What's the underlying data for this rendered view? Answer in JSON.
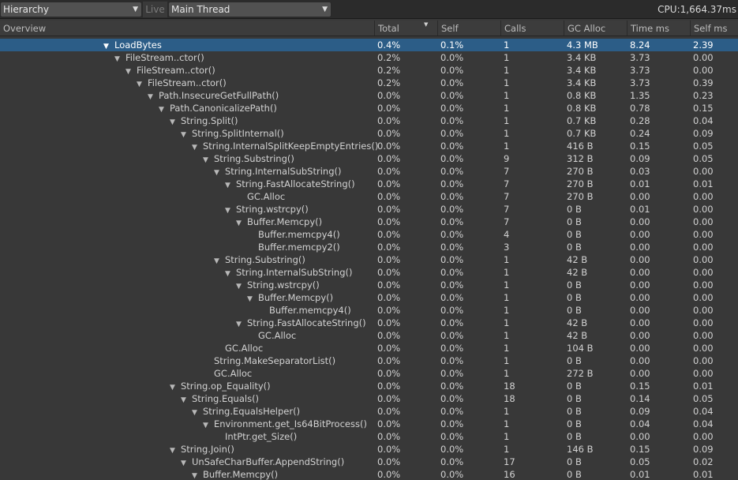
{
  "toolbar": {
    "view_mode": "Hierarchy",
    "live_label": "Live",
    "thread": "Main Thread",
    "cpu": "CPU:1,664.37ms"
  },
  "columns": [
    "Overview",
    "Total",
    "Self",
    "Calls",
    "GC Alloc",
    "Time ms",
    "Self ms"
  ],
  "rows": [
    {
      "name": "LoadBytes",
      "depth": 0,
      "expanded": true,
      "selected": true,
      "total": "0.4%",
      "self": "0.1%",
      "calls": "1",
      "gc_alloc": "4.3 MB",
      "time_ms": "8.24",
      "self_ms": "2.39"
    },
    {
      "name": "FileStream..ctor()",
      "depth": 1,
      "expanded": true,
      "total": "0.2%",
      "self": "0.0%",
      "calls": "1",
      "gc_alloc": "3.4 KB",
      "time_ms": "3.73",
      "self_ms": "0.00"
    },
    {
      "name": "FileStream..ctor()",
      "depth": 2,
      "expanded": true,
      "total": "0.2%",
      "self": "0.0%",
      "calls": "1",
      "gc_alloc": "3.4 KB",
      "time_ms": "3.73",
      "self_ms": "0.00"
    },
    {
      "name": "FileStream..ctor()",
      "depth": 3,
      "expanded": true,
      "total": "0.2%",
      "self": "0.0%",
      "calls": "1",
      "gc_alloc": "3.4 KB",
      "time_ms": "3.73",
      "self_ms": "0.39"
    },
    {
      "name": "Path.InsecureGetFullPath()",
      "depth": 4,
      "expanded": true,
      "total": "0.0%",
      "self": "0.0%",
      "calls": "1",
      "gc_alloc": "0.8 KB",
      "time_ms": "1.35",
      "self_ms": "0.23"
    },
    {
      "name": "Path.CanonicalizePath()",
      "depth": 5,
      "expanded": true,
      "total": "0.0%",
      "self": "0.0%",
      "calls": "1",
      "gc_alloc": "0.8 KB",
      "time_ms": "0.78",
      "self_ms": "0.15"
    },
    {
      "name": "String.Split()",
      "depth": 6,
      "expanded": true,
      "total": "0.0%",
      "self": "0.0%",
      "calls": "1",
      "gc_alloc": "0.7 KB",
      "time_ms": "0.28",
      "self_ms": "0.04"
    },
    {
      "name": "String.SplitInternal()",
      "depth": 7,
      "expanded": true,
      "total": "0.0%",
      "self": "0.0%",
      "calls": "1",
      "gc_alloc": "0.7 KB",
      "time_ms": "0.24",
      "self_ms": "0.09"
    },
    {
      "name": "String.InternalSplitKeepEmptyEntries()",
      "depth": 8,
      "expanded": true,
      "total": "0.0%",
      "self": "0.0%",
      "calls": "1",
      "gc_alloc": "416 B",
      "time_ms": "0.15",
      "self_ms": "0.05"
    },
    {
      "name": "String.Substring()",
      "depth": 9,
      "expanded": true,
      "total": "0.0%",
      "self": "0.0%",
      "calls": "9",
      "gc_alloc": "312 B",
      "time_ms": "0.09",
      "self_ms": "0.05"
    },
    {
      "name": "String.InternalSubString()",
      "depth": 10,
      "expanded": true,
      "total": "0.0%",
      "self": "0.0%",
      "calls": "7",
      "gc_alloc": "270 B",
      "time_ms": "0.03",
      "self_ms": "0.00"
    },
    {
      "name": "String.FastAllocateString()",
      "depth": 11,
      "expanded": true,
      "total": "0.0%",
      "self": "0.0%",
      "calls": "7",
      "gc_alloc": "270 B",
      "time_ms": "0.01",
      "self_ms": "0.01"
    },
    {
      "name": "GC.Alloc",
      "depth": 12,
      "expanded": false,
      "total": "0.0%",
      "self": "0.0%",
      "calls": "7",
      "gc_alloc": "270 B",
      "time_ms": "0.00",
      "self_ms": "0.00"
    },
    {
      "name": "String.wstrcpy()",
      "depth": 11,
      "expanded": true,
      "total": "0.0%",
      "self": "0.0%",
      "calls": "7",
      "gc_alloc": "0 B",
      "time_ms": "0.01",
      "self_ms": "0.00"
    },
    {
      "name": "Buffer.Memcpy()",
      "depth": 12,
      "expanded": true,
      "total": "0.0%",
      "self": "0.0%",
      "calls": "7",
      "gc_alloc": "0 B",
      "time_ms": "0.00",
      "self_ms": "0.00"
    },
    {
      "name": "Buffer.memcpy4()",
      "depth": 13,
      "expanded": false,
      "total": "0.0%",
      "self": "0.0%",
      "calls": "4",
      "gc_alloc": "0 B",
      "time_ms": "0.00",
      "self_ms": "0.00"
    },
    {
      "name": "Buffer.memcpy2()",
      "depth": 13,
      "expanded": false,
      "total": "0.0%",
      "self": "0.0%",
      "calls": "3",
      "gc_alloc": "0 B",
      "time_ms": "0.00",
      "self_ms": "0.00"
    },
    {
      "name": "String.Substring()",
      "depth": 10,
      "expanded": true,
      "total": "0.0%",
      "self": "0.0%",
      "calls": "1",
      "gc_alloc": "42 B",
      "time_ms": "0.00",
      "self_ms": "0.00"
    },
    {
      "name": "String.InternalSubString()",
      "depth": 11,
      "expanded": true,
      "total": "0.0%",
      "self": "0.0%",
      "calls": "1",
      "gc_alloc": "42 B",
      "time_ms": "0.00",
      "self_ms": "0.00"
    },
    {
      "name": "String.wstrcpy()",
      "depth": 12,
      "expanded": true,
      "total": "0.0%",
      "self": "0.0%",
      "calls": "1",
      "gc_alloc": "0 B",
      "time_ms": "0.00",
      "self_ms": "0.00"
    },
    {
      "name": "Buffer.Memcpy()",
      "depth": 13,
      "expanded": true,
      "total": "0.0%",
      "self": "0.0%",
      "calls": "1",
      "gc_alloc": "0 B",
      "time_ms": "0.00",
      "self_ms": "0.00"
    },
    {
      "name": "Buffer.memcpy4()",
      "depth": 14,
      "expanded": false,
      "total": "0.0%",
      "self": "0.0%",
      "calls": "1",
      "gc_alloc": "0 B",
      "time_ms": "0.00",
      "self_ms": "0.00"
    },
    {
      "name": "String.FastAllocateString()",
      "depth": 12,
      "expanded": true,
      "total": "0.0%",
      "self": "0.0%",
      "calls": "1",
      "gc_alloc": "42 B",
      "time_ms": "0.00",
      "self_ms": "0.00"
    },
    {
      "name": "GC.Alloc",
      "depth": 13,
      "expanded": false,
      "total": "0.0%",
      "self": "0.0%",
      "calls": "1",
      "gc_alloc": "42 B",
      "time_ms": "0.00",
      "self_ms": "0.00"
    },
    {
      "name": "GC.Alloc",
      "depth": 10,
      "expanded": false,
      "total": "0.0%",
      "self": "0.0%",
      "calls": "1",
      "gc_alloc": "104 B",
      "time_ms": "0.00",
      "self_ms": "0.00"
    },
    {
      "name": "String.MakeSeparatorList()",
      "depth": 9,
      "expanded": false,
      "total": "0.0%",
      "self": "0.0%",
      "calls": "1",
      "gc_alloc": "0 B",
      "time_ms": "0.00",
      "self_ms": "0.00"
    },
    {
      "name": "GC.Alloc",
      "depth": 9,
      "expanded": false,
      "total": "0.0%",
      "self": "0.0%",
      "calls": "1",
      "gc_alloc": "272 B",
      "time_ms": "0.00",
      "self_ms": "0.00"
    },
    {
      "name": "String.op_Equality()",
      "depth": 6,
      "expanded": true,
      "total": "0.0%",
      "self": "0.0%",
      "calls": "18",
      "gc_alloc": "0 B",
      "time_ms": "0.15",
      "self_ms": "0.01"
    },
    {
      "name": "String.Equals()",
      "depth": 7,
      "expanded": true,
      "total": "0.0%",
      "self": "0.0%",
      "calls": "18",
      "gc_alloc": "0 B",
      "time_ms": "0.14",
      "self_ms": "0.05"
    },
    {
      "name": "String.EqualsHelper()",
      "depth": 8,
      "expanded": true,
      "total": "0.0%",
      "self": "0.0%",
      "calls": "1",
      "gc_alloc": "0 B",
      "time_ms": "0.09",
      "self_ms": "0.04"
    },
    {
      "name": "Environment.get_Is64BitProcess()",
      "depth": 9,
      "expanded": true,
      "total": "0.0%",
      "self": "0.0%",
      "calls": "1",
      "gc_alloc": "0 B",
      "time_ms": "0.04",
      "self_ms": "0.04"
    },
    {
      "name": "IntPtr.get_Size()",
      "depth": 10,
      "expanded": false,
      "total": "0.0%",
      "self": "0.0%",
      "calls": "1",
      "gc_alloc": "0 B",
      "time_ms": "0.00",
      "self_ms": "0.00"
    },
    {
      "name": "String.Join()",
      "depth": 6,
      "expanded": true,
      "total": "0.0%",
      "self": "0.0%",
      "calls": "1",
      "gc_alloc": "146 B",
      "time_ms": "0.15",
      "self_ms": "0.09"
    },
    {
      "name": "UnSafeCharBuffer.AppendString()",
      "depth": 7,
      "expanded": true,
      "total": "0.0%",
      "self": "0.0%",
      "calls": "17",
      "gc_alloc": "0 B",
      "time_ms": "0.05",
      "self_ms": "0.02"
    },
    {
      "name": "Buffer.Memcpy()",
      "depth": 8,
      "expanded": true,
      "total": "0.0%",
      "self": "0.0%",
      "calls": "16",
      "gc_alloc": "0 B",
      "time_ms": "0.01",
      "self_ms": "0.01"
    }
  ]
}
